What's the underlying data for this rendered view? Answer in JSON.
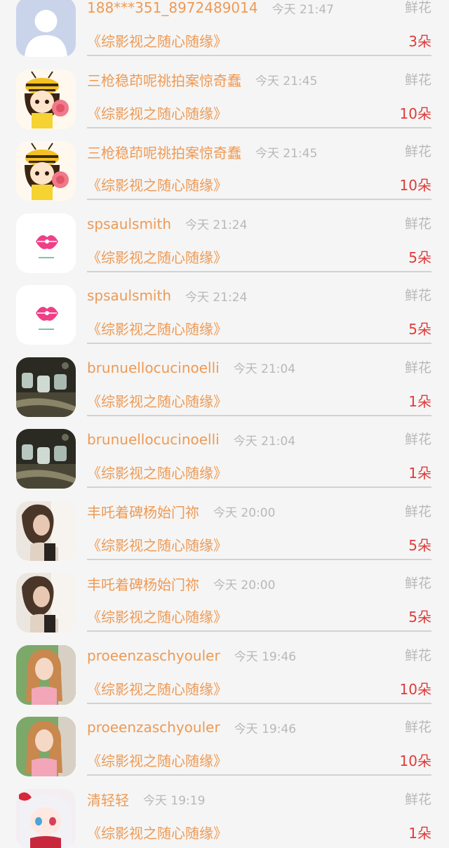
{
  "records": [
    {
      "user_name": "188***351_8972489014",
      "time": "今天 21:47",
      "gift_type": "鲜花",
      "novel": "《综影视之随心随缘》",
      "count": "3朵",
      "avatar": "default-avatar-icon"
    },
    {
      "user_name": "三枪稳茚呢祧拍案惊奇蠢",
      "time": "今天 21:45",
      "gift_type": "鲜花",
      "novel": "《综影视之随心随缘》",
      "count": "10朵",
      "avatar": "bee-girl-avatar"
    },
    {
      "user_name": "三枪稳茚呢祧拍案惊奇蠢",
      "time": "今天 21:45",
      "gift_type": "鲜花",
      "novel": "《综影视之随心随缘》",
      "count": "10朵",
      "avatar": "bee-girl-avatar"
    },
    {
      "user_name": "spsaulsmith",
      "time": "今天 21:24",
      "gift_type": "鲜花",
      "novel": "《综影视之随心随缘》",
      "count": "5朵",
      "avatar": "pink-lips-avatar"
    },
    {
      "user_name": "spsaulsmith",
      "time": "今天 21:24",
      "gift_type": "鲜花",
      "novel": "《综影视之随心随缘》",
      "count": "5朵",
      "avatar": "pink-lips-avatar"
    },
    {
      "user_name": "brunuellocucinoelli",
      "time": "今天 21:04",
      "gift_type": "鲜花",
      "novel": "《综影视之随心随缘》",
      "count": "1朵",
      "avatar": "glass-jars-avatar"
    },
    {
      "user_name": "brunuellocucinoelli",
      "time": "今天 21:04",
      "gift_type": "鲜花",
      "novel": "《综影视之随心随缘》",
      "count": "1朵",
      "avatar": "glass-jars-avatar"
    },
    {
      "user_name": "丰吒着碑杨始门祢",
      "time": "今天 20:00",
      "gift_type": "鲜花",
      "novel": "《综影视之随心随缘》",
      "count": "5朵",
      "avatar": "woman-photo-avatar"
    },
    {
      "user_name": "丰吒着碑杨始门祢",
      "time": "今天 20:00",
      "gift_type": "鲜花",
      "novel": "《综影视之随心随缘》",
      "count": "5朵",
      "avatar": "woman-photo-avatar"
    },
    {
      "user_name": "proeenzaschyouler",
      "time": "今天 19:46",
      "gift_type": "鲜花",
      "novel": "《综影视之随心随缘》",
      "count": "10朵",
      "avatar": "blonde-girl-avatar"
    },
    {
      "user_name": "proeenzaschyouler",
      "time": "今天 19:46",
      "gift_type": "鲜花",
      "novel": "《综影视之随心随缘》",
      "count": "10朵",
      "avatar": "blonde-girl-avatar"
    },
    {
      "user_name": "清轻轻",
      "time": "今天 19:19",
      "gift_type": "鲜花",
      "novel": "《综影视之随心随缘》",
      "count": "1朵",
      "avatar": "anime-girl-avatar"
    }
  ]
}
